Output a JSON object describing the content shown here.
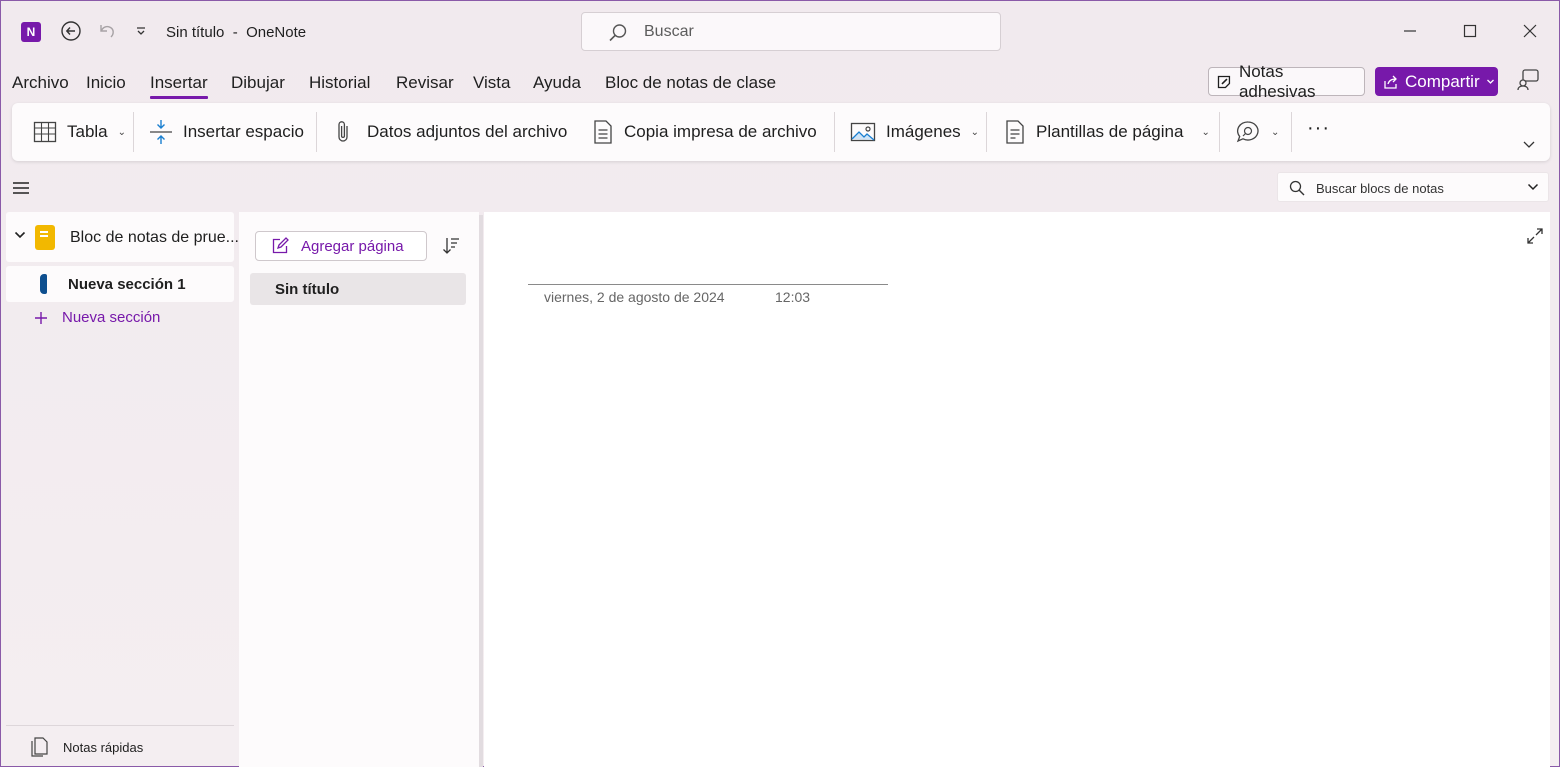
{
  "window": {
    "title": "Sin título",
    "title_sep": "-",
    "app_name": "OneNote",
    "app_icon_letter": "N",
    "accent_color": "#7719aa"
  },
  "search": {
    "placeholder": "Buscar"
  },
  "menu": {
    "tabs": [
      "Archivo",
      "Inicio",
      "Insertar",
      "Dibujar",
      "Historial",
      "Revisar",
      "Vista",
      "Ayuda",
      "Bloc de notas de clase"
    ],
    "active_tab": "Insertar",
    "sticky_notes_label": "Notas adhesivas",
    "share_label": "Compartir"
  },
  "ribbon": {
    "table_label": "Tabla",
    "insert_space_label": "Insertar espacio",
    "attachment_label": "Datos adjuntos del archivo",
    "printout_label": "Copia impresa de archivo",
    "images_label": "Imágenes",
    "templates_label": "Plantillas de página",
    "more_label": "···"
  },
  "notebook_search": {
    "placeholder": "Buscar blocs de notas"
  },
  "nav": {
    "notebook_name": "Bloc de notas de prue...",
    "section_name": "Nueva sección 1",
    "new_section_label": "Nueva sección",
    "quick_notes_label": "Notas rápidas"
  },
  "pages": {
    "add_page_label": "Agregar página",
    "items": [
      {
        "title": "Sin título",
        "selected": true
      }
    ]
  },
  "canvas": {
    "date": "viernes, 2 de agosto de 2024",
    "time": "12:03"
  }
}
